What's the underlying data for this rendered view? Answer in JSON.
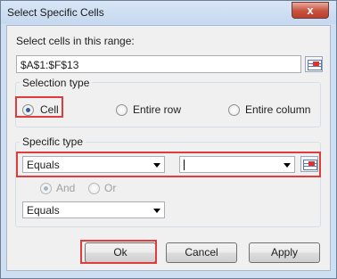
{
  "window": {
    "title": "Select Specific Cells",
    "close_glyph": "x"
  },
  "range": {
    "label": "Select cells in this range:",
    "value": "$A$1:$F$13",
    "picker_icon": "range-select-icon"
  },
  "selection_type": {
    "legend": "Selection type",
    "options": [
      {
        "label": "Cell",
        "checked": true
      },
      {
        "label": "Entire row",
        "checked": false
      },
      {
        "label": "Entire column",
        "checked": false
      }
    ]
  },
  "specific_type": {
    "legend": "Specific type",
    "condition1": {
      "value": "Equals",
      "input_value": ""
    },
    "logic": [
      {
        "label": "And",
        "checked": true
      },
      {
        "label": "Or",
        "checked": false
      }
    ],
    "condition2": {
      "value": "Equals"
    }
  },
  "buttons": {
    "ok": "Ok",
    "cancel": "Cancel",
    "apply": "Apply"
  },
  "colors": {
    "highlight": "#e03c3c",
    "title_bg": "#cfdff2",
    "dialog_bg": "#f0f0f0"
  }
}
